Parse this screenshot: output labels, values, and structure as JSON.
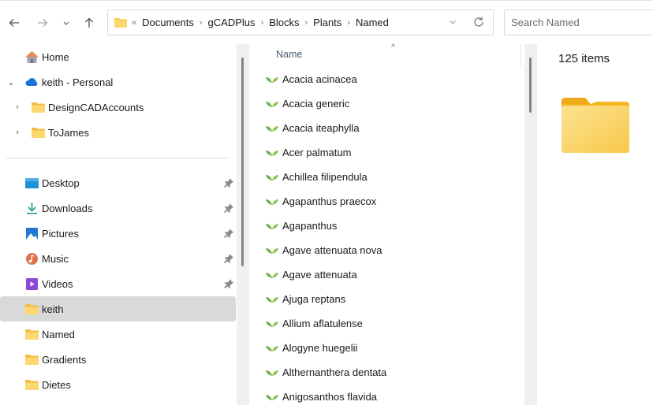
{
  "toolbar": {
    "back_label": "Back",
    "forward_label": "Forward",
    "recent_label": "Recent locations",
    "up_label": "Up"
  },
  "address": {
    "overflow": "«",
    "breadcrumbs": [
      "Documents",
      "gCADPlus",
      "Blocks",
      "Plants",
      "Named"
    ]
  },
  "search": {
    "placeholder": "Search Named"
  },
  "sidebar": {
    "items": [
      {
        "label": "Home",
        "icon": "home-icon"
      },
      {
        "label": "keith - Personal",
        "icon": "onedrive-cloud-icon",
        "expanded": true
      },
      {
        "label": "DesignCADAccounts",
        "icon": "folder-icon",
        "expandable": true
      },
      {
        "label": "ToJames",
        "icon": "folder-icon",
        "expandable": true
      },
      {
        "label": "Desktop",
        "icon": "desktop-icon",
        "pinned": true
      },
      {
        "label": "Downloads",
        "icon": "download-icon",
        "pinned": true
      },
      {
        "label": "Pictures",
        "icon": "pictures-icon",
        "pinned": true
      },
      {
        "label": "Music",
        "icon": "music-icon",
        "pinned": true
      },
      {
        "label": "Videos",
        "icon": "videos-icon",
        "pinned": true
      },
      {
        "label": "keith",
        "icon": "folder-icon",
        "selected": true
      },
      {
        "label": "Named",
        "icon": "folder-icon"
      },
      {
        "label": "Gradients",
        "icon": "folder-icon"
      },
      {
        "label": "Dietes",
        "icon": "folder-icon"
      }
    ]
  },
  "file_list": {
    "column_header": "Name",
    "sort": "ascending",
    "files": [
      "Acacia acinacea",
      "Acacia generic",
      "Acacia iteaphylla",
      "Acer palmatum",
      "Achillea filipendula",
      "Agapanthus praecox",
      "Agapanthus",
      "Agave attenuata nova",
      "Agave attenuata",
      "Ajuga reptans",
      "Allium aflatulense",
      "Alogyne huegelii",
      "Althernanthera dentata",
      "Anigosanthos flavida"
    ]
  },
  "preview": {
    "item_count": "125 items"
  },
  "colors": {
    "folder": "#f8c94c",
    "leaf": "#6ab04c",
    "selected_bg": "#d9d9d9",
    "scroll_thumb": "#858585"
  }
}
